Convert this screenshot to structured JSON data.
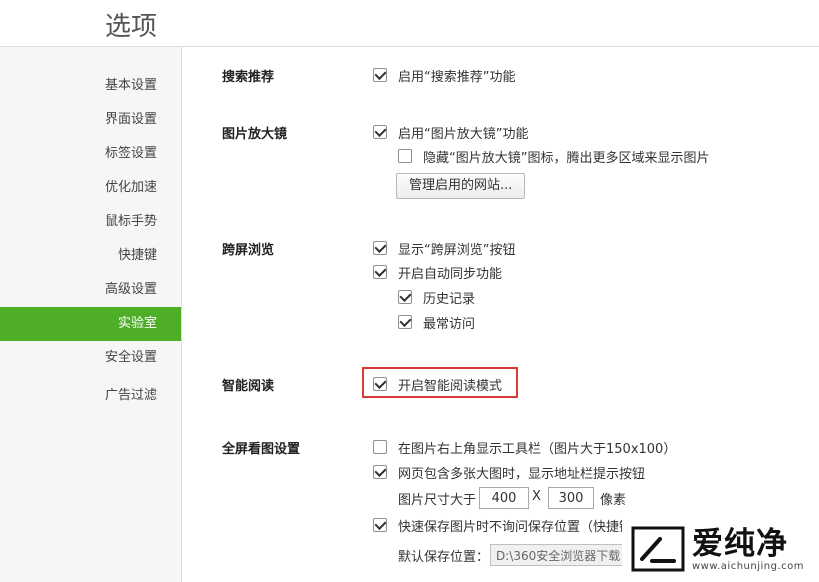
{
  "window": {
    "title": "选项"
  },
  "sidebar": {
    "items": [
      {
        "label": "基本设置"
      },
      {
        "label": "界面设置"
      },
      {
        "label": "标签设置"
      },
      {
        "label": "优化加速"
      },
      {
        "label": "鼠标手势"
      },
      {
        "label": "快捷键"
      },
      {
        "label": "高级设置"
      },
      {
        "label": "实验室",
        "active": true
      },
      {
        "label": "安全设置"
      },
      {
        "label": "广告过滤"
      }
    ]
  },
  "sections": {
    "search": {
      "label": "搜索推荐",
      "options": [
        {
          "label": "启用“搜索推荐”功能",
          "checked": true
        }
      ]
    },
    "magnifier": {
      "label": "图片放大镜",
      "options": [
        {
          "label": "启用“图片放大镜”功能",
          "checked": true
        },
        {
          "label": "隐藏“图片放大镜”图标，腾出更多区域来显示图片",
          "checked": false
        }
      ],
      "manage_button": "管理启用的网站..."
    },
    "cross_screen": {
      "label": "跨屏浏览",
      "options": [
        {
          "label": "显示“跨屏浏览”按钮",
          "checked": true
        },
        {
          "label": "开启自动同步功能",
          "checked": true
        },
        {
          "label": "历史记录",
          "checked": true
        },
        {
          "label": "最常访问",
          "checked": true
        }
      ]
    },
    "smart_reading": {
      "label": "智能阅读",
      "options": [
        {
          "label": "开启智能阅读模式",
          "checked": true
        }
      ]
    },
    "fullscreen": {
      "label": "全屏看图设置",
      "options": [
        {
          "label": "在图片右上角显示工具栏（图片大于150x100）",
          "checked": false
        },
        {
          "label": "网页包含多张大图时，显示地址栏提示按钮",
          "checked": true
        },
        {
          "label": "快速保存图片时不询问保存位置（快捷键",
          "checked": true
        }
      ],
      "size_label": "图片尺寸大于",
      "width_value": "400",
      "times": "X",
      "height_value": "300",
      "unit": "像素",
      "save_path_label": "默认保存位置：",
      "save_path_value": "D:\\360安全浏览器下载"
    }
  },
  "watermark": {
    "text": "爱纯净",
    "url": "www.aichunjing.com"
  },
  "colors": {
    "accent": "#4fae27",
    "highlight": "#d83a3a"
  }
}
